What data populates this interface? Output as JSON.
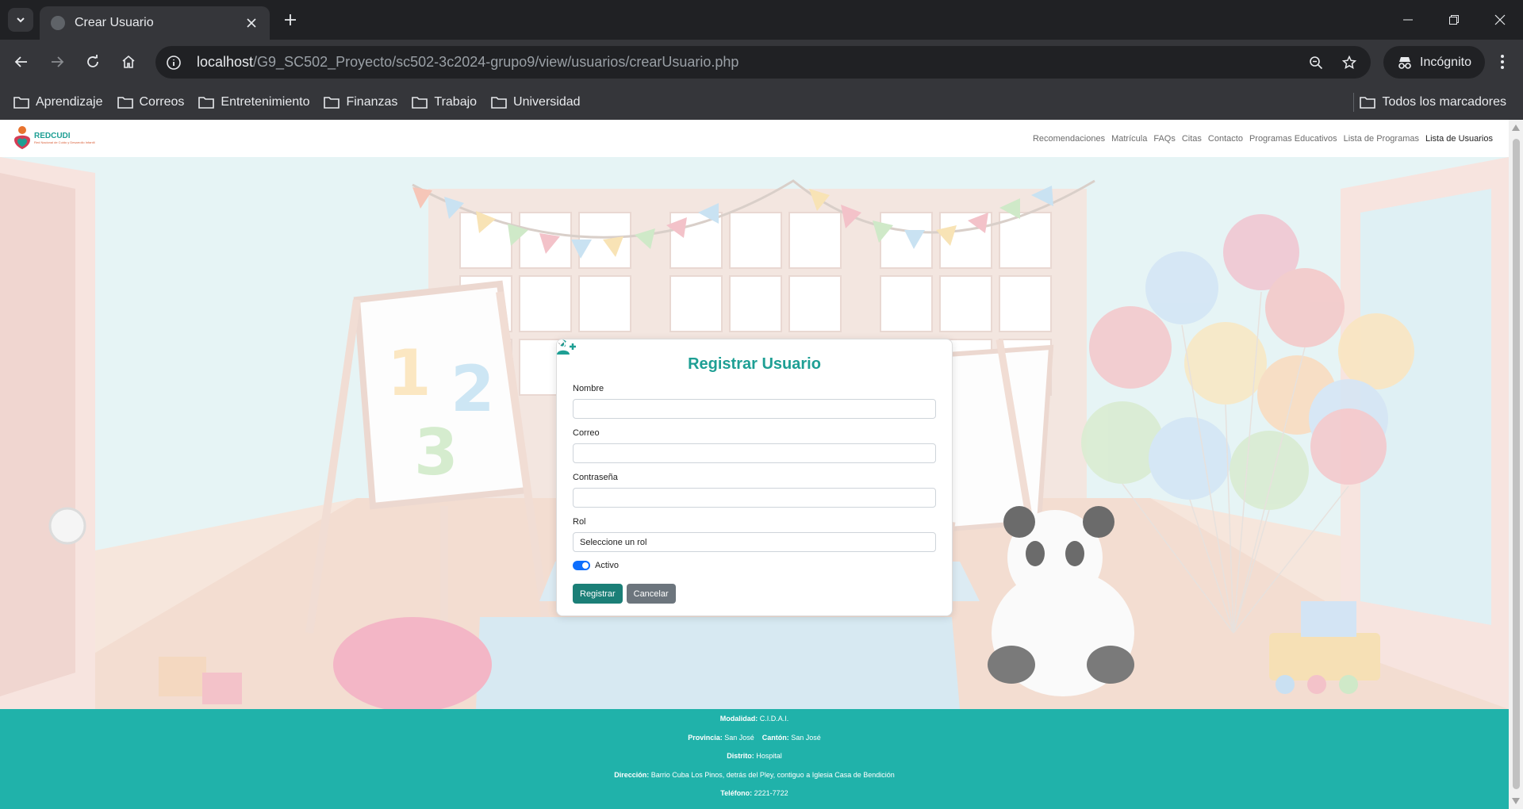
{
  "browser": {
    "tab_title": "Crear Usuario",
    "url_host": "localhost",
    "url_path": "/G9_SC502_Proyecto/sc502-3c2024-grupo9/view/usuarios/crearUsuario.php",
    "incognito_label": "Incógnito",
    "bookmarks": [
      "Aprendizaje",
      "Correos",
      "Entretenimiento",
      "Finanzas",
      "Trabajo",
      "Universidad"
    ],
    "all_bookmarks_label": "Todos los marcadores"
  },
  "site": {
    "logo_title": "REDCUDI",
    "logo_subtitle": "Red Nacional de Cuido y Desarrollo Infantil",
    "nav": [
      "Recomendaciones",
      "Matrícula",
      "FAQs",
      "Citas",
      "Contacto",
      "Programas Educativos",
      "Lista de Programas",
      "Lista de Usuarios"
    ],
    "active_nav": "Lista de Usuarios"
  },
  "form": {
    "title": "Registrar Usuario",
    "name_label": "Nombre",
    "name_value": "",
    "email_label": "Correo",
    "email_value": "",
    "password_label": "Contraseña",
    "password_value": "",
    "role_label": "Rol",
    "role_selected": "Seleccione un rol",
    "active_label": "Activo",
    "active_checked": true,
    "submit_label": "Registrar",
    "cancel_label": "Cancelar"
  },
  "footer": {
    "modalidad_label": "Modalidad:",
    "modalidad_value": "C.I.D.A.I.",
    "provincia_label": "Provincia:",
    "provincia_value": "San José",
    "canton_label": "Cantón:",
    "canton_value": "San José",
    "distrito_label": "Distrito:",
    "distrito_value": "Hospital",
    "direccion_label": "Dirección:",
    "direccion_value": "Barrio Cuba Los Pinos, detrás del Pley, contiguo a Iglesia Casa de Bendición",
    "telefono_label": "Teléfono:",
    "telefono_value": "2221-7722"
  },
  "colors": {
    "brand": "#1e9f94",
    "footer_bg": "#20b2aa",
    "primary_button": "#1b7f77",
    "secondary_button": "#6c757d",
    "switch_on": "#0d6efd"
  },
  "icons": {
    "tab_search": "chevron-down-icon",
    "back": "arrow-left-icon",
    "forward": "arrow-right-icon",
    "reload": "reload-icon",
    "home": "home-icon",
    "zoom": "zoom-icon",
    "star": "star-icon",
    "folder": "folder-icon",
    "user_plus": "user-plus-icon",
    "ban": "ban-icon"
  }
}
